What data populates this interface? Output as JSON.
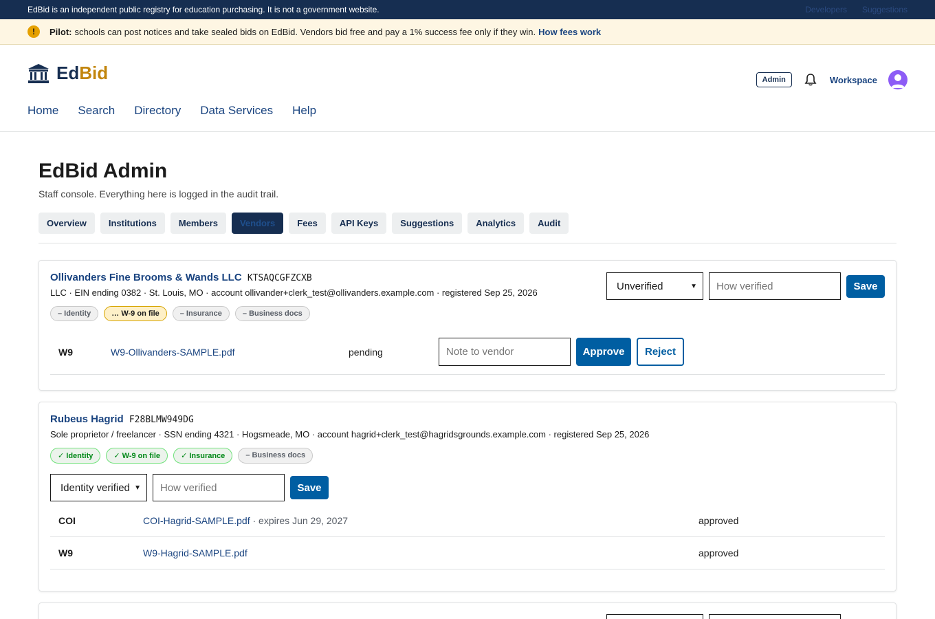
{
  "topbar": {
    "disclaimer": "EdBid is an independent public registry for education purchasing. It is not a government website.",
    "links": [
      "Developers",
      "Suggestions"
    ]
  },
  "banner": {
    "label": "Pilot:",
    "text": "schools can post notices and take sealed bids on EdBid. Vendors bid free and pay a 1% success fee only if they win.",
    "link": "How fees work"
  },
  "header": {
    "logo_ed": "Ed",
    "logo_bid": "Bid",
    "nav": [
      "Home",
      "Search",
      "Directory",
      "Data Services",
      "Help"
    ],
    "admin_badge": "Admin",
    "workspace": "Workspace"
  },
  "page": {
    "title": "EdBid Admin",
    "subtitle": "Staff console. Everything here is logged in the audit trail."
  },
  "tabs": [
    "Overview",
    "Institutions",
    "Members",
    "Vendors",
    "Fees",
    "API Keys",
    "Suggestions",
    "Analytics",
    "Audit"
  ],
  "active_tab": "Vendors",
  "vendors": [
    {
      "name": "Ollivanders Fine Brooms & Wands LLC",
      "code": "KTSAQCGFZCXB",
      "meta": "LLC · EIN ending 0382 · St. Louis, MO · account ollivander+clerk_test@ollivanders.example.com · registered Sep 25, 2026",
      "chips": [
        "– Identity",
        "… W-9 on file",
        "– Insurance",
        "– Business docs"
      ],
      "status_select": "Unverified",
      "how_verified_placeholder": "How verified",
      "save_label": "Save",
      "docs": [
        {
          "type": "W9",
          "file": "W9-Ollivanders-SAMPLE.pdf",
          "status": "pending",
          "note_placeholder": "Note to vendor",
          "approve_label": "Approve",
          "reject_label": "Reject"
        }
      ]
    },
    {
      "name": "Rubeus Hagrid",
      "code": "F28BLMW949DG",
      "meta": "Sole proprietor / freelancer · SSN ending 4321 · Hogsmeade, MO · account hagrid+clerk_test@hagridsgrounds.example.com · registered Sep 25, 2026",
      "chips": [
        "✓ Identity",
        "✓ W-9 on file",
        "✓ Insurance",
        "– Business docs"
      ],
      "status_select": "Identity verified",
      "how_verified_placeholder": "How verified",
      "save_label": "Save",
      "docs": [
        {
          "type": "COI",
          "file": "COI-Hagrid-SAMPLE.pdf",
          "expiry": "· expires Jun 29, 2027",
          "status": "approved"
        },
        {
          "type": "W9",
          "file": "W9-Hagrid-SAMPLE.pdf",
          "status": "approved"
        }
      ]
    }
  ],
  "colors": {
    "navy": "#162e51",
    "primary": "#005ea2",
    "gold": "#c2850c",
    "banner_bg": "#fef6e3"
  }
}
